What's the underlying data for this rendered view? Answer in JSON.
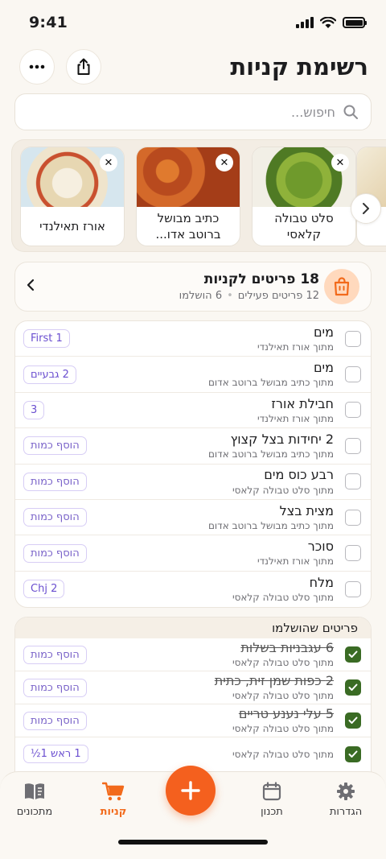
{
  "status": {
    "time": "9:41"
  },
  "header": {
    "title": "רשימת קניות"
  },
  "search": {
    "placeholder": "חיפוש..."
  },
  "recipes": [
    {
      "name": "אורז תאילנדי"
    },
    {
      "name": "כתיב מבושל ברוטב אדו..."
    },
    {
      "name": "סלט טבולה קלאסי"
    }
  ],
  "recipe_peek_text": "ד",
  "summary": {
    "title": "18 פריטים לקניות",
    "active": "12 פריטים פעילים",
    "done": "6 הושלמו"
  },
  "items": [
    {
      "name": "מים",
      "source": "מתוך אורז תאילנדי",
      "qty": "First 1"
    },
    {
      "name": "מים",
      "source": "מתוך כתיב מבושל ברוטב אדום",
      "qty": "2 גבעיים"
    },
    {
      "name": "חבילת אורז",
      "source": "מתוך אורז תאילנדי",
      "qty": "3"
    },
    {
      "name": "2 יחידות בצל קצוץ",
      "source": "מתוך כתיב מבושל ברוטב אדום",
      "qty": "הוסף כמות"
    },
    {
      "name": "רבע כוס מים",
      "source": "מתוך סלט טבולה קלאסי",
      "qty": "הוסף כמות"
    },
    {
      "name": "מצית בצל",
      "source": "מתוך כתיב מבושל ברוטב אדום",
      "qty": "הוסף כמות"
    },
    {
      "name": "סוכר",
      "source": "מתוך אורז תאילנדי",
      "qty": "הוסף כמות"
    },
    {
      "name": "מלח",
      "source": "מתוך סלט טבולה קלאסי",
      "qty": "2 Chj"
    }
  ],
  "completed": {
    "title": "פריטים שהושלמו",
    "items": [
      {
        "name": "6 עגבניות בשלות",
        "source": "מתוך סלט טבולה קלאסי",
        "qty": "הוסף כמות"
      },
      {
        "name": "2 כפות שמן זית, כתית",
        "source": "מתוך סלט טבולה קלאסי",
        "qty": "הוסף כמות"
      },
      {
        "name": "5 עלי נענע טריים",
        "source": "מתוך סלט טבולה קלאסי",
        "qty": "הוסף כמות"
      },
      {
        "name": "",
        "source": "מתוך סלט טבולה קלאסי",
        "qty": "1 ראש 1½"
      }
    ]
  },
  "nav": {
    "recipes": "מתכונים",
    "shopping": "קניות",
    "planner": "תכנון",
    "settings": "הגדרות"
  },
  "colors": {
    "accent": "#f4601e",
    "check": "#3a6b24",
    "chip": "#6b4fd0"
  }
}
